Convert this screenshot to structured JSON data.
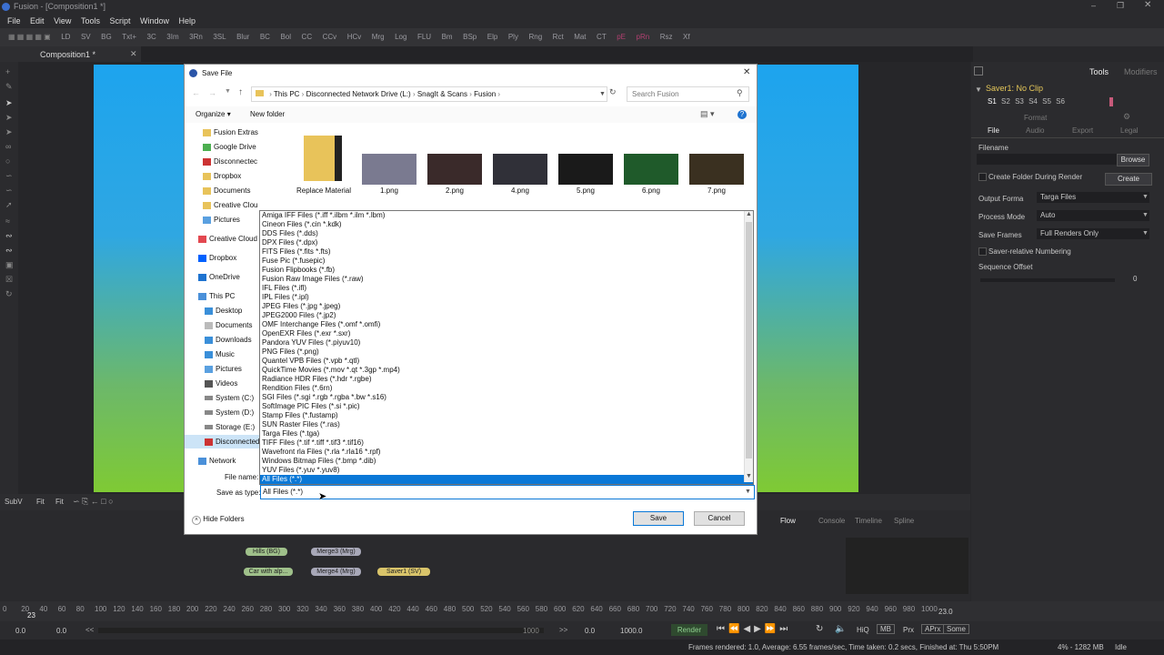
{
  "window": {
    "title": "Fusion - [Composition1 *]"
  },
  "menu": [
    "File",
    "Edit",
    "View",
    "Tools",
    "Script",
    "Window",
    "Help"
  ],
  "toolbar": [
    "LD",
    "SV",
    "BG",
    "Txt+",
    "3C",
    "3Im",
    "3Rn",
    "3SL",
    "Blur",
    "BC",
    "Bol",
    "CC",
    "CCv",
    "HCv",
    "Mrg",
    "Log",
    "FLU",
    "Bm",
    "BSp",
    "Elp",
    "Ply",
    "Rng",
    "Rct",
    "Mat",
    "CT",
    "pE",
    "pRn",
    "Rsz",
    "Xf"
  ],
  "tabs": {
    "composition": "Composition1 *"
  },
  "right_panel": {
    "tabs": [
      "Tools",
      "Modifiers"
    ],
    "node_title": "Saver1: No Clip",
    "slots": [
      "S1",
      "S2",
      "S3",
      "S4",
      "S5",
      "S6"
    ],
    "format_header": "Format",
    "subtabs": [
      "File",
      "Audio",
      "Export",
      "Legal"
    ],
    "filename_label": "Filename",
    "browse": "Browse",
    "create_folder": "Create Folder During Render",
    "create": "Create",
    "output_format_label": "Output Forma",
    "output_format_value": "Targa Files",
    "process_mode_label": "Process Mode",
    "process_mode_value": "Auto",
    "save_frames_label": "Save Frames",
    "save_frames_value": "Full Renders Only",
    "saver_relative": "Saver-relative Numbering",
    "sequence_offset_label": "Sequence Offset",
    "sequence_offset_value": "0"
  },
  "viewer_ctrls": {
    "subv": "SubV",
    "fit1": "Fit",
    "fit2": "Fit"
  },
  "flow_tabs": [
    "Flow",
    "Console",
    "Timeline",
    "Spline"
  ],
  "nodes": {
    "hills": "Hills (BG)",
    "merge3": "Merge3 (Mrg)",
    "car": "Car with alp...",
    "merge4": "Merge4 (Mrg)",
    "saver": "Saver1 (SV)"
  },
  "timeline": {
    "ticks": [
      "0",
      "20",
      "40",
      "60",
      "80",
      "100",
      "120",
      "140",
      "160",
      "180",
      "200",
      "220",
      "240",
      "260",
      "280",
      "300",
      "320",
      "340",
      "360",
      "380",
      "400",
      "420",
      "440",
      "460",
      "480",
      "500",
      "520",
      "540",
      "560",
      "580",
      "600",
      "620",
      "640",
      "660",
      "680",
      "700",
      "720",
      "740",
      "760",
      "780",
      "800",
      "820",
      "840",
      "860",
      "880",
      "900",
      "920",
      "940",
      "960",
      "980",
      "1000"
    ],
    "current": "23",
    "current_right": "23.0"
  },
  "transport": {
    "start": "0.0",
    "render_start": "0.0",
    "render_end": "1000",
    "render_end2": "0.0",
    "end": "1000.0",
    "render": "Render",
    "hiq": "HiQ",
    "mb": "MB",
    "prx": "Prx",
    "aprx": "APrx",
    "some": "Some"
  },
  "status": {
    "message": "Frames rendered: 1.0,  Average: 6.55 frames/sec,  Time taken: 0.2 secs,  Finished at: Thu 5:50PM",
    "memory": "4% - 1282 MB",
    "state": "Idle"
  },
  "dialog": {
    "title": "Save File",
    "breadcrumb": [
      "This PC",
      "Disconnected Network Drive (L:)",
      "SnagIt & Scans",
      "Fusion"
    ],
    "search_placeholder": "Search Fusion",
    "organize": "Organize",
    "new_folder": "New folder",
    "nav_items": [
      "Fusion Extras",
      "Google Drive",
      "Disconnectec",
      "Dropbox",
      "Documents",
      "Creative Clou",
      "Pictures",
      "Creative Cloud",
      "Dropbox",
      "OneDrive",
      "This PC",
      "Desktop",
      "Documents",
      "Downloads",
      "Music",
      "Pictures",
      "Videos",
      "System (C:)",
      "System (D:)",
      "Storage (E:)",
      "Disconnected",
      "Network"
    ],
    "files": [
      "Replace Material",
      "1.png",
      "2.png",
      "4.png",
      "5.png",
      "6.png",
      "7.png"
    ],
    "file_name_label": "File name:",
    "save_as_type_label": "Save as type:",
    "save_as_type_value": "All Files (*.*)",
    "hide_folders": "Hide Folders",
    "save": "Save",
    "cancel": "Cancel",
    "type_options": [
      "Amiga IFF Files (*.iff *.ilbm *.ilm *.lbm)",
      "Cineon Files (*.cin *.kdk)",
      "DDS Files (*.dds)",
      "DPX Files (*.dpx)",
      "FITS Files (*.fits *.fts)",
      "Fuse Pic (*.fusepic)",
      "Fusion Flipbooks (*.fb)",
      "Fusion Raw Image Files (*.raw)",
      "IFL Files (*.ifl)",
      "IPL Files (*.ipl)",
      "JPEG Files (*.jpg *.jpeg)",
      "JPEG2000 Files (*.jp2)",
      "OMF Interchange Files (*.omf *.omfi)",
      "OpenEXR Files (*.exr *.sxr)",
      "Pandora YUV Files (*.piyuv10)",
      "PNG Files (*.png)",
      "Quantel VPB Files (*.vpb *.qtl)",
      "QuickTime Movies (*.mov *.qt *.3gp *.mp4)",
      "Radiance HDR Files (*.hdr *.rgbe)",
      "Rendition Files (*.6rn)",
      "SGI Files (*.sgi *.rgb *.rgba *.bw *.s16)",
      "SoftImage PIC Files (*.si *.pic)",
      "Stamp Files (*.fustamp)",
      "SUN Raster Files (*.ras)",
      "Targa Files (*.tga)",
      "TIFF Files (*.tif *.tiff *.tif3 *.tif16)",
      "Wavefront rla Files (*.rla *.rla16 *.rpf)",
      "Windows Bitmap Files (*.bmp *.dib)",
      "YUV Files (*.yuv *.yuv8)",
      "All Files (*.*)"
    ]
  }
}
